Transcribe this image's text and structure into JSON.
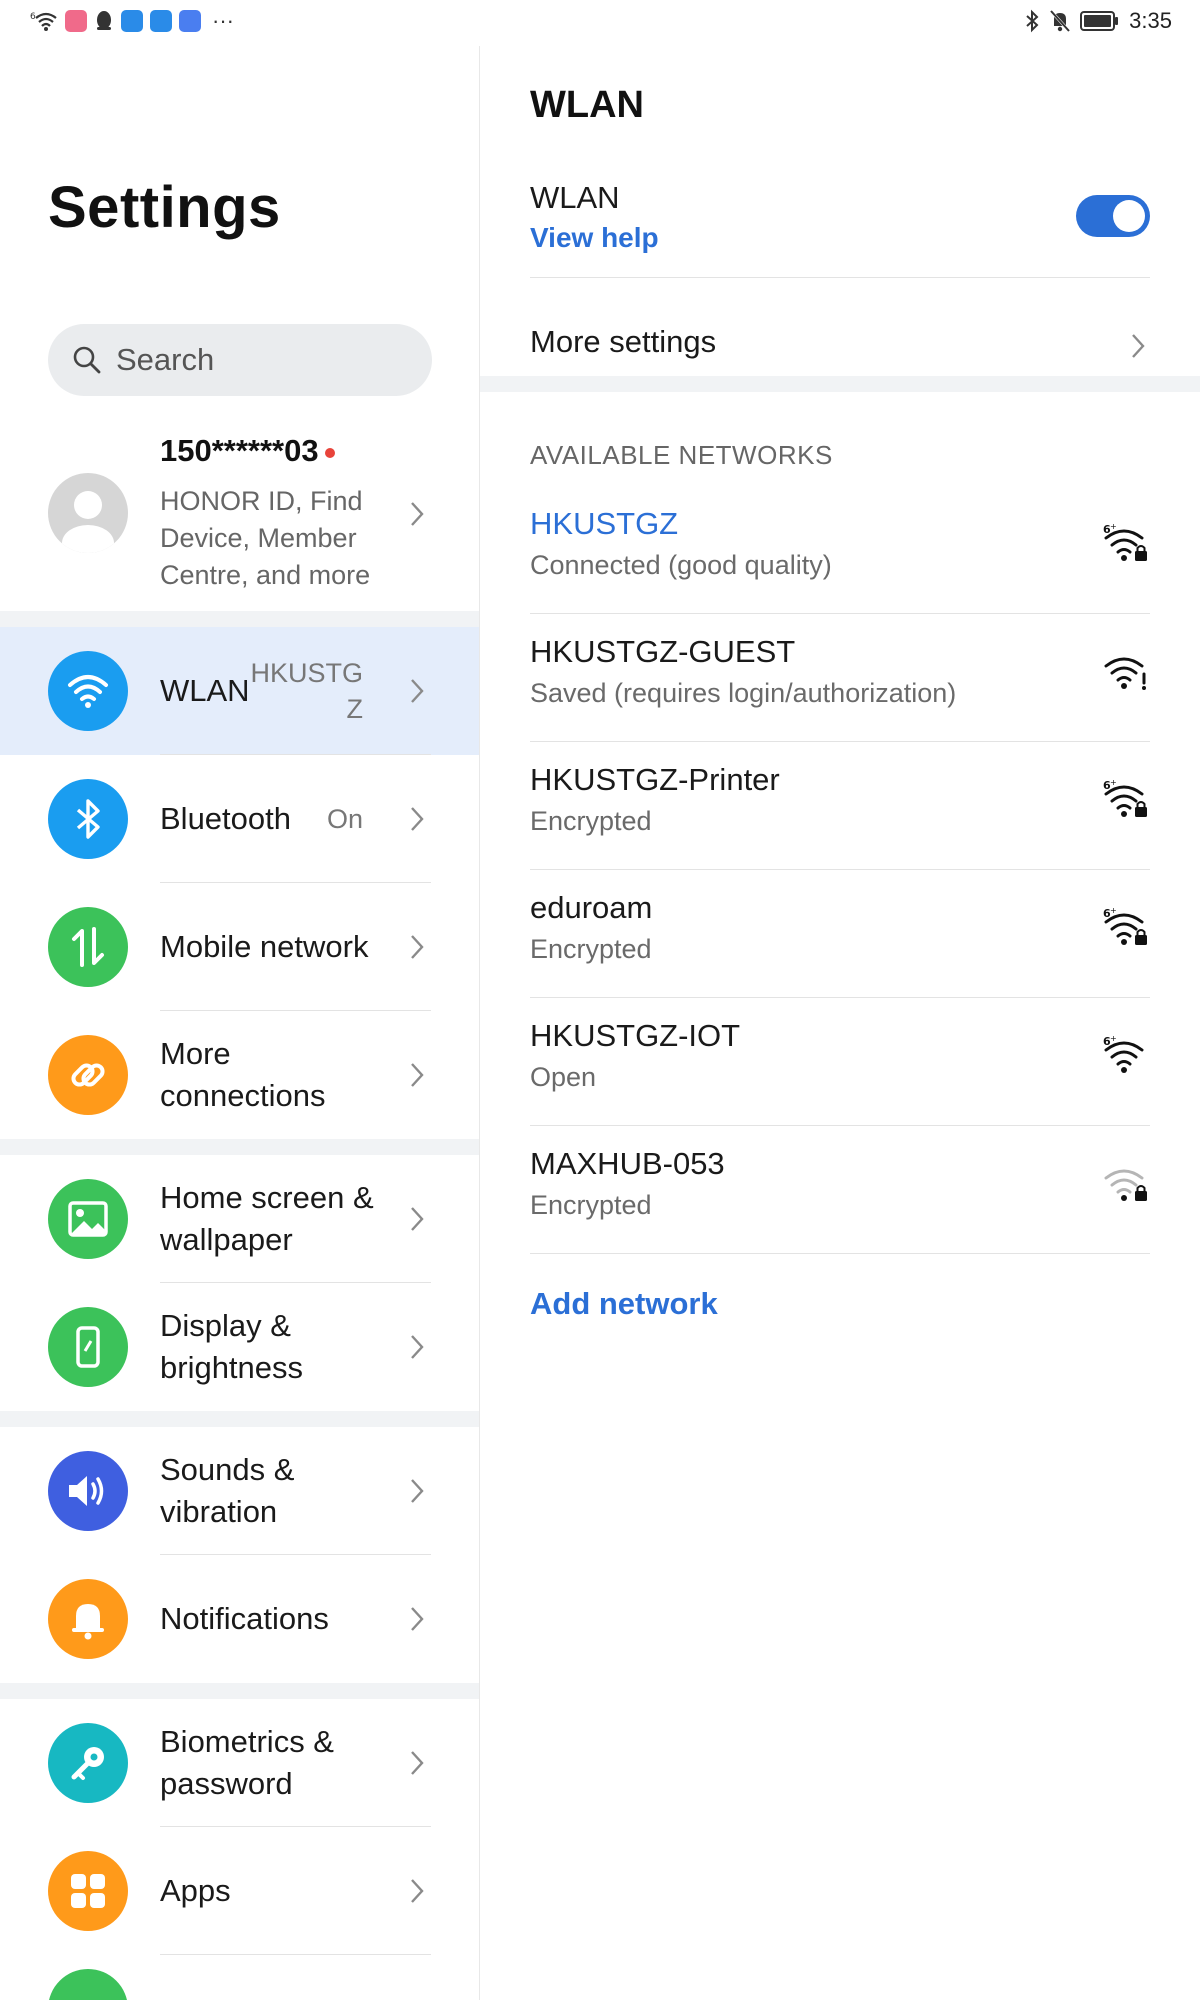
{
  "status_bar": {
    "time": "3:35",
    "left_icons": [
      "wifi-6-icon",
      "app-icon-pink",
      "qq-icon",
      "app-icon-blue",
      "cloud-icon",
      "mail-icon"
    ],
    "more_indicator": "···",
    "right_icons": [
      "bluetooth-icon",
      "mute-icon",
      "battery-icon"
    ]
  },
  "left_pane": {
    "title": "Settings",
    "search_placeholder": "Search",
    "account": {
      "name": "150******03",
      "description": "HONOR ID, Find Device, Member Centre, and more"
    },
    "groups": [
      [
        {
          "label": "WLAN",
          "value": "HKUSTGZ",
          "icon": "wifi-icon",
          "color": "#1a9df0",
          "selected": true
        },
        {
          "label": "Bluetooth",
          "value": "On",
          "icon": "bluetooth-icon",
          "color": "#1a9df0"
        },
        {
          "label": "Mobile network",
          "value": "",
          "icon": "mobile-data-icon",
          "color": "#3cc25a"
        },
        {
          "label": "More connections",
          "value": "",
          "icon": "link-icon",
          "color": "#ff9a1a"
        }
      ],
      [
        {
          "label": "Home screen & wallpaper",
          "value": "",
          "icon": "image-icon",
          "color": "#3cc25a"
        },
        {
          "label": "Display & brightness",
          "value": "",
          "icon": "display-icon",
          "color": "#3cc25a"
        }
      ],
      [
        {
          "label": "Sounds & vibration",
          "value": "",
          "icon": "speaker-icon",
          "color": "#3f5fe0"
        },
        {
          "label": "Notifications",
          "value": "",
          "icon": "bell-icon",
          "color": "#ff9a1a"
        }
      ],
      [
        {
          "label": "Biometrics & password",
          "value": "",
          "icon": "key-icon",
          "color": "#17b8c2"
        },
        {
          "label": "Apps",
          "value": "",
          "icon": "apps-grid-icon",
          "color": "#ff9a1a"
        },
        {
          "label": "",
          "value": "",
          "icon": "green-partial-icon",
          "color": "#3cc25a"
        }
      ]
    ]
  },
  "right_pane": {
    "title": "WLAN",
    "wlan_toggle": {
      "label": "WLAN",
      "help": "View help",
      "on": true
    },
    "more_settings": "More settings",
    "available_header": "AVAILABLE NETWORKS",
    "networks": [
      {
        "name": "HKUSTGZ",
        "status": "Connected (good quality)",
        "connected": true,
        "icon": "wifi6-lock-icon",
        "locked": true,
        "wifi6": true,
        "weak": false
      },
      {
        "name": "HKUSTGZ-GUEST",
        "status": "Saved (requires login/authorization)",
        "connected": false,
        "icon": "wifi-alert-icon",
        "locked": false,
        "wifi6": false,
        "weak": false,
        "alert": true
      },
      {
        "name": "HKUSTGZ-Printer",
        "status": "Encrypted",
        "connected": false,
        "icon": "wifi6-lock-icon",
        "locked": true,
        "wifi6": true,
        "weak": false
      },
      {
        "name": "eduroam",
        "status": "Encrypted",
        "connected": false,
        "icon": "wifi6-lock-icon",
        "locked": true,
        "wifi6": true,
        "weak": false
      },
      {
        "name": "HKUSTGZ-IOT",
        "status": "Open",
        "connected": false,
        "icon": "wifi6-icon",
        "locked": false,
        "wifi6": true,
        "weak": false
      },
      {
        "name": "MAXHUB-053",
        "status": "Encrypted",
        "connected": false,
        "icon": "wifi-weak-lock-icon",
        "locked": true,
        "wifi6": false,
        "weak": true
      }
    ],
    "add_network": "Add network"
  }
}
